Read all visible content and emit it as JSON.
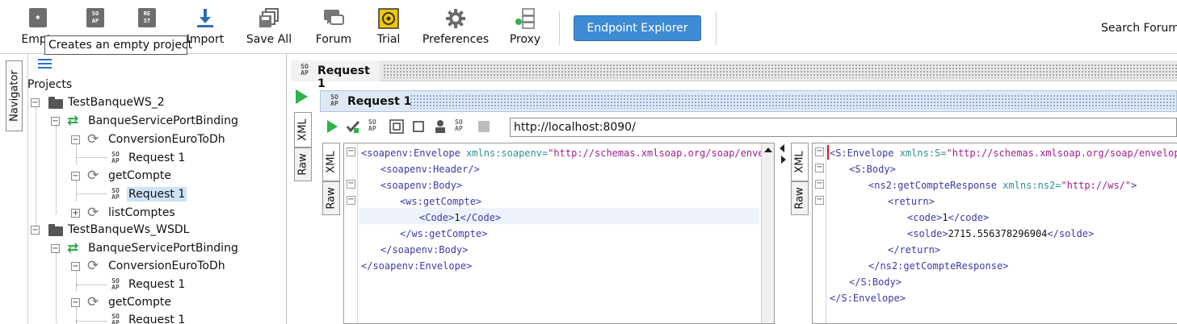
{
  "toolbar": {
    "empty_label": "Empty",
    "import_label": "Import",
    "save_all_label": "Save All",
    "forum_label": "Forum",
    "trial_label": "Trial",
    "preferences_label": "Preferences",
    "proxy_label": "Proxy",
    "endpoint_explorer_label": "Endpoint Explorer",
    "search_forum_label": "Search Forum",
    "tooltip": "Creates an empty project",
    "soap_badge": "SO\nAP",
    "rest_badge": "RE\nST"
  },
  "navigator": {
    "tab_label": "Navigator",
    "projects_label": "Projects",
    "tree": [
      {
        "label": "TestBanqueWS_2",
        "kind": "project"
      },
      {
        "label": "BanqueServicePortBinding",
        "kind": "binding"
      },
      {
        "label": "ConversionEuroToDh",
        "kind": "operation"
      },
      {
        "label": "Request 1",
        "kind": "request"
      },
      {
        "label": "getCompte",
        "kind": "operation"
      },
      {
        "label": "Request 1",
        "kind": "request",
        "selected": true
      },
      {
        "label": "listComptes",
        "kind": "operation"
      },
      {
        "label": "TestBanqueWs_WSDL",
        "kind": "project"
      },
      {
        "label": "BanqueServicePortBinding",
        "kind": "binding"
      },
      {
        "label": "ConversionEuroToDh",
        "kind": "operation"
      },
      {
        "label": "Request 1",
        "kind": "request"
      },
      {
        "label": "getCompte",
        "kind": "operation"
      },
      {
        "label": "Request 1",
        "kind": "request"
      }
    ]
  },
  "editor": {
    "outer_tab_label": "Request 1",
    "inner_title": "Request 1",
    "xml_tab": "XML",
    "raw_tab": "Raw",
    "url": "http://localhost:8090/"
  },
  "request_xml": [
    [
      {
        "c": "tg",
        "t": "<soapenv:Envelope "
      },
      {
        "c": "at",
        "t": "xmlns:soapenv="
      },
      {
        "c": "st",
        "t": "\"http://schemas.xmlsoap.org/soap/envelope/\""
      }
    ],
    [
      {
        "c": "tg",
        "t": "<soapenv:Header/>"
      }
    ],
    [
      {
        "c": "tg",
        "t": "<soapenv:Body>"
      }
    ],
    [
      {
        "c": "tg",
        "t": "<ws:getCompte>"
      }
    ],
    [
      {
        "c": "tg",
        "t": "<Code>"
      },
      {
        "c": "tx",
        "t": "1"
      },
      {
        "c": "tg",
        "t": "</Code>"
      }
    ],
    [
      {
        "c": "tg",
        "t": "</ws:getCompte>"
      }
    ],
    [
      {
        "c": "tg",
        "t": "</soapenv:Body>"
      }
    ],
    [
      {
        "c": "tg",
        "t": "</soapenv:Envelope>"
      }
    ]
  ],
  "response_xml": [
    [
      {
        "c": "tg",
        "t": "<S:Envelope "
      },
      {
        "c": "at",
        "t": "xmlns:S="
      },
      {
        "c": "st",
        "t": "\"http://schemas.xmlsoap.org/soap/envelope/\""
      }
    ],
    [
      {
        "c": "tg",
        "t": "<S:Body>"
      }
    ],
    [
      {
        "c": "tg",
        "t": "<ns2:getCompteResponse "
      },
      {
        "c": "at",
        "t": "xmlns:ns2="
      },
      {
        "c": "st",
        "t": "\"http://ws/\""
      },
      {
        "c": "tg",
        "t": ">"
      }
    ],
    [
      {
        "c": "tg",
        "t": "<return>"
      }
    ],
    [
      {
        "c": "tg",
        "t": "<code>"
      },
      {
        "c": "tx",
        "t": "1"
      },
      {
        "c": "tg",
        "t": "</code>"
      }
    ],
    [
      {
        "c": "tg",
        "t": "<solde>"
      },
      {
        "c": "tx",
        "t": "2715.556378296904"
      },
      {
        "c": "tg",
        "t": "</solde>"
      }
    ],
    [
      {
        "c": "tg",
        "t": "</return>"
      }
    ],
    [
      {
        "c": "tg",
        "t": "</ns2:getCompteResponse>"
      }
    ],
    [
      {
        "c": "tg",
        "t": "</S:Body>"
      }
    ],
    [
      {
        "c": "tg",
        "t": "</S:Envelope>"
      }
    ]
  ],
  "colors": {
    "accent": "#3d8bd4",
    "run_green": "#2fb24a",
    "selection": "#cfe3f7",
    "xml_tag": "#3a3aa8",
    "xml_attr": "#2f8f8f",
    "xml_string": "#a0208a"
  }
}
